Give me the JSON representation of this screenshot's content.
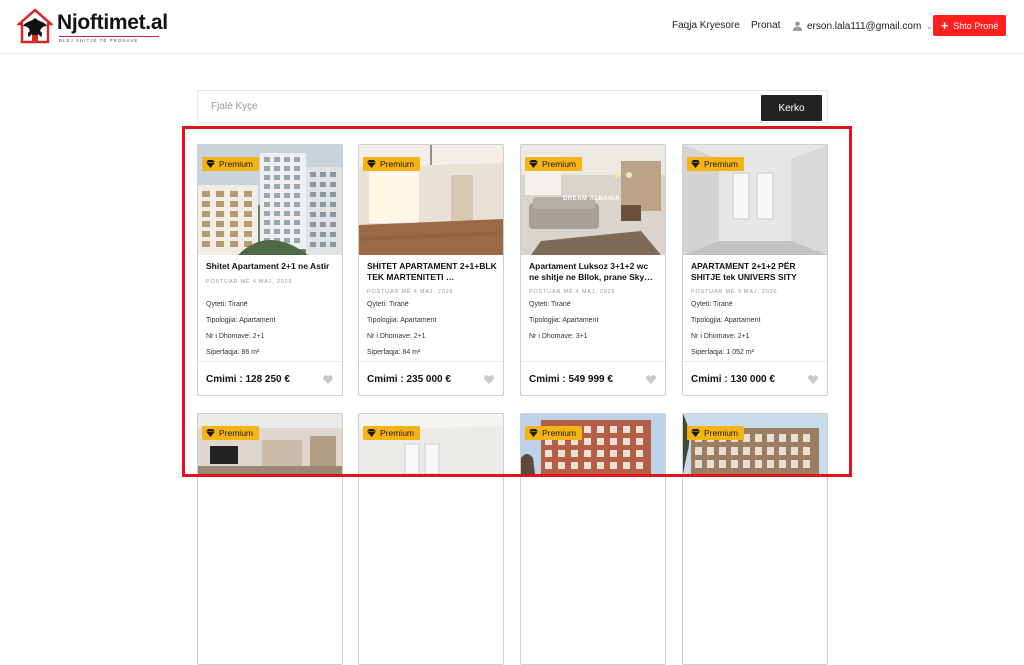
{
  "header": {
    "logo_text": "Njoftimet.al",
    "logo_tagline": "BLEJ SHITJE TË PRONAVE",
    "nav": {
      "home": "Faqja Kryesore",
      "properties": "Pronat"
    },
    "user_email": "erson.lala111@gmail.com",
    "add_button": "Shto Pronë",
    "add_plus": "+"
  },
  "search": {
    "placeholder": "Fjalë Kyçe",
    "button": "Kerko"
  },
  "labels": {
    "premium": "Premium",
    "city": "Qyteti: ",
    "typology": "Tipologjia: ",
    "rooms": "Nr i Dhomave: ",
    "area": "Siperfaqja: ",
    "price": "Cmimi : "
  },
  "listings": [
    {
      "title": "Shitet Apartament 2+1 ne Astir",
      "date": "POSTUAR MË 4 MAJ, 2026",
      "city": "Tiranë",
      "typology": "Apartament",
      "rooms": "2+1",
      "area": "86 m²",
      "price": "128 250 €",
      "photo": "building-render"
    },
    {
      "title": "SHITET APARTAMENT 2+1+BLK TEK MARTENITETI …",
      "date": "POSTUAR MË 4 MAJ, 2026",
      "city": "Tiranë",
      "typology": "Apartament",
      "rooms": "2+1",
      "area": "84 m²",
      "price": "235 000 €",
      "photo": "empty-room-wood"
    },
    {
      "title": "Apartament Luksoz 3+1+2 wc ne shitje ne Bllok, prane Sky…",
      "date": "POSTUAR MË 4 MAJ, 2026",
      "city": "Tiranë",
      "typology": "Apartament",
      "rooms": "3+1",
      "area": null,
      "price": "549 999 €",
      "photo": "living-room",
      "watermark": "DREAM ALBANIA"
    },
    {
      "title": "APARTAMENT 2+1+2 PËR SHITJE tek UNIVERS SITY",
      "date": "POSTUAR MË 3 MAJ, 2026",
      "city": "Tiranë",
      "typology": "Apartament",
      "rooms": "2+1",
      "area": "1 052 m²",
      "price": "130 000 €",
      "photo": "empty-room-white"
    },
    {
      "photo": "kitchen-interior"
    },
    {
      "photo": "white-room-windows"
    },
    {
      "photo": "brick-building"
    },
    {
      "photo": "residential-block"
    }
  ],
  "colors": {
    "accent": "#ff1f1f",
    "premium": "#f5b414",
    "highlight": "#e0141a",
    "search_button": "#222222"
  }
}
